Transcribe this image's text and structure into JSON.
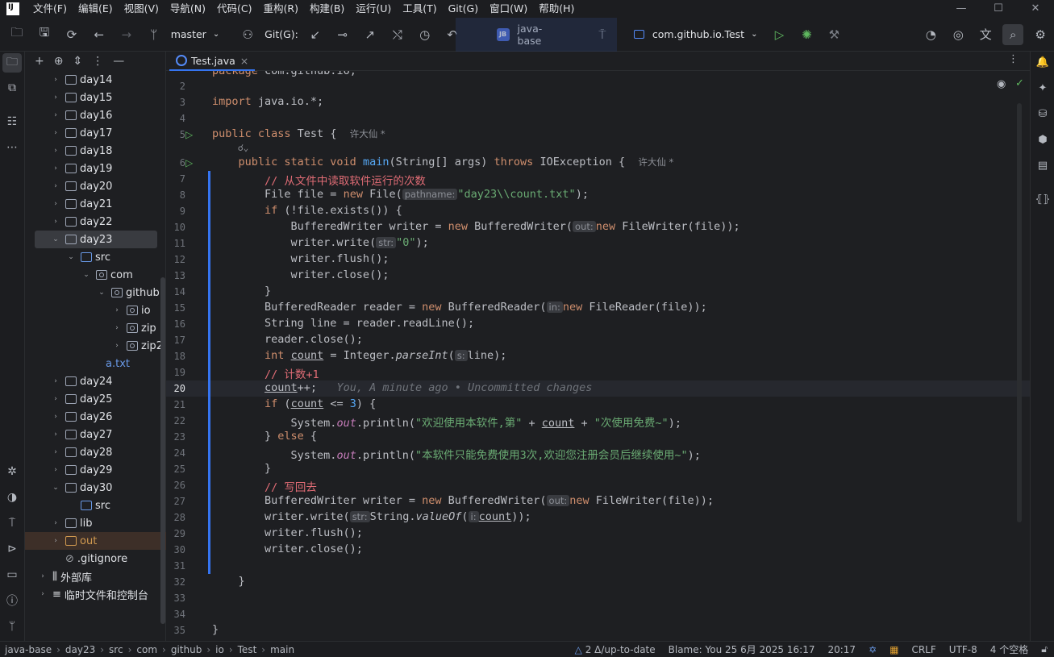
{
  "menu": [
    "文件(F)",
    "编辑(E)",
    "视图(V)",
    "导航(N)",
    "代码(C)",
    "重构(R)",
    "构建(B)",
    "运行(U)",
    "工具(T)",
    "Git(G)",
    "窗口(W)",
    "帮助(H)"
  ],
  "toolbar": {
    "branch": "master",
    "git_label": "Git(G):",
    "project_badge": "JB",
    "project_name": "java-base",
    "run_config": "com.github.io.Test"
  },
  "tabs": [
    {
      "label": "Test.java",
      "close": "×"
    }
  ],
  "tree": [
    {
      "label": "day14",
      "kind": "folder",
      "indent": 0,
      "arrow": "›"
    },
    {
      "label": "day15",
      "kind": "folder",
      "indent": 0,
      "arrow": "›"
    },
    {
      "label": "day16",
      "kind": "folder",
      "indent": 0,
      "arrow": "›"
    },
    {
      "label": "day17",
      "kind": "folder",
      "indent": 0,
      "arrow": "›"
    },
    {
      "label": "day18",
      "kind": "folder",
      "indent": 0,
      "arrow": "›"
    },
    {
      "label": "day19",
      "kind": "folder",
      "indent": 0,
      "arrow": "›"
    },
    {
      "label": "day20",
      "kind": "folder",
      "indent": 0,
      "arrow": "›"
    },
    {
      "label": "day21",
      "kind": "folder",
      "indent": 0,
      "arrow": "›"
    },
    {
      "label": "day22",
      "kind": "folder",
      "indent": 0,
      "arrow": "›"
    },
    {
      "label": "day23",
      "kind": "folder",
      "indent": 0,
      "arrow": "⌄",
      "selected": true
    },
    {
      "label": "src",
      "kind": "src",
      "indent": 1,
      "arrow": "⌄"
    },
    {
      "label": "com",
      "kind": "pkg",
      "indent": 2,
      "arrow": "⌄"
    },
    {
      "label": "github",
      "kind": "pkg",
      "indent": 3,
      "arrow": "⌄"
    },
    {
      "label": "io",
      "kind": "pkg",
      "indent": 4,
      "arrow": "›"
    },
    {
      "label": "zip",
      "kind": "pkg",
      "indent": 4,
      "arrow": "›"
    },
    {
      "label": "zip2",
      "kind": "pkg",
      "indent": 4,
      "arrow": "›"
    },
    {
      "label": "a.txt",
      "kind": "file",
      "indent": 2,
      "arrow": ""
    },
    {
      "label": "day24",
      "kind": "folder",
      "indent": 0,
      "arrow": "›"
    },
    {
      "label": "day25",
      "kind": "folder",
      "indent": 0,
      "arrow": "›"
    },
    {
      "label": "day26",
      "kind": "folder",
      "indent": 0,
      "arrow": "›"
    },
    {
      "label": "day27",
      "kind": "folder",
      "indent": 0,
      "arrow": "›"
    },
    {
      "label": "day28",
      "kind": "folder",
      "indent": 0,
      "arrow": "›"
    },
    {
      "label": "day29",
      "kind": "folder",
      "indent": 0,
      "arrow": "›"
    },
    {
      "label": "day30",
      "kind": "folder",
      "indent": 0,
      "arrow": "⌄"
    },
    {
      "label": "src",
      "kind": "src",
      "indent": 1,
      "arrow": ""
    },
    {
      "label": "lib",
      "kind": "folder",
      "indent": 0,
      "arrow": "›"
    },
    {
      "label": "out",
      "kind": "out",
      "indent": 0,
      "arrow": "›"
    },
    {
      "label": ".gitignore",
      "kind": "ignore",
      "indent": 0,
      "arrow": ""
    },
    {
      "label": "外部库",
      "kind": "lib",
      "indent": -1,
      "arrow": "›"
    },
    {
      "label": "临时文件和控制台",
      "kind": "scratch",
      "indent": -1,
      "arrow": "›"
    }
  ],
  "editor": {
    "line_numbers": [
      "2",
      "3",
      "4",
      "5",
      "",
      "6",
      "7",
      "8",
      "9",
      "10",
      "11",
      "12",
      "13",
      "14",
      "15",
      "16",
      "17",
      "18",
      "19",
      "20",
      "21",
      "22",
      "23",
      "24",
      "25",
      "26",
      "27",
      "28",
      "29",
      "30",
      "31",
      "32",
      "33",
      "34",
      "35"
    ],
    "author": "许大仙 *",
    "hints": {
      "pathname": "pathname:",
      "out": "out:",
      "str": "str:",
      "in": "in:",
      "s": "s:",
      "i": "i:"
    },
    "strings": {
      "path": "\"day23\\\\count.txt\"",
      "zero": "\"0\"",
      "welcome": "\"欢迎使用本软件,第\"",
      "times": "\"次使用免费~\"",
      "limit": "\"本软件只能免费使用3次,欢迎您注册会员后继续使用~\""
    },
    "comments": {
      "read": "// 从文件中读取软件运行的次数",
      "count": "// 计数+1",
      "write": "// 写回去"
    },
    "blame_inline": "You, A minute ago • Uncommitted changes"
  },
  "statusbar": {
    "crumbs": [
      "java-base",
      "day23",
      "src",
      "com",
      "github",
      "io",
      "Test",
      "main"
    ],
    "vcs": "2 Δ/up-to-date",
    "blame": "Blame: You 25 6月 2025 16:17",
    "position": "20:17",
    "line_sep": "CRLF",
    "encoding": "UTF-8",
    "indent": "4 个空格"
  }
}
